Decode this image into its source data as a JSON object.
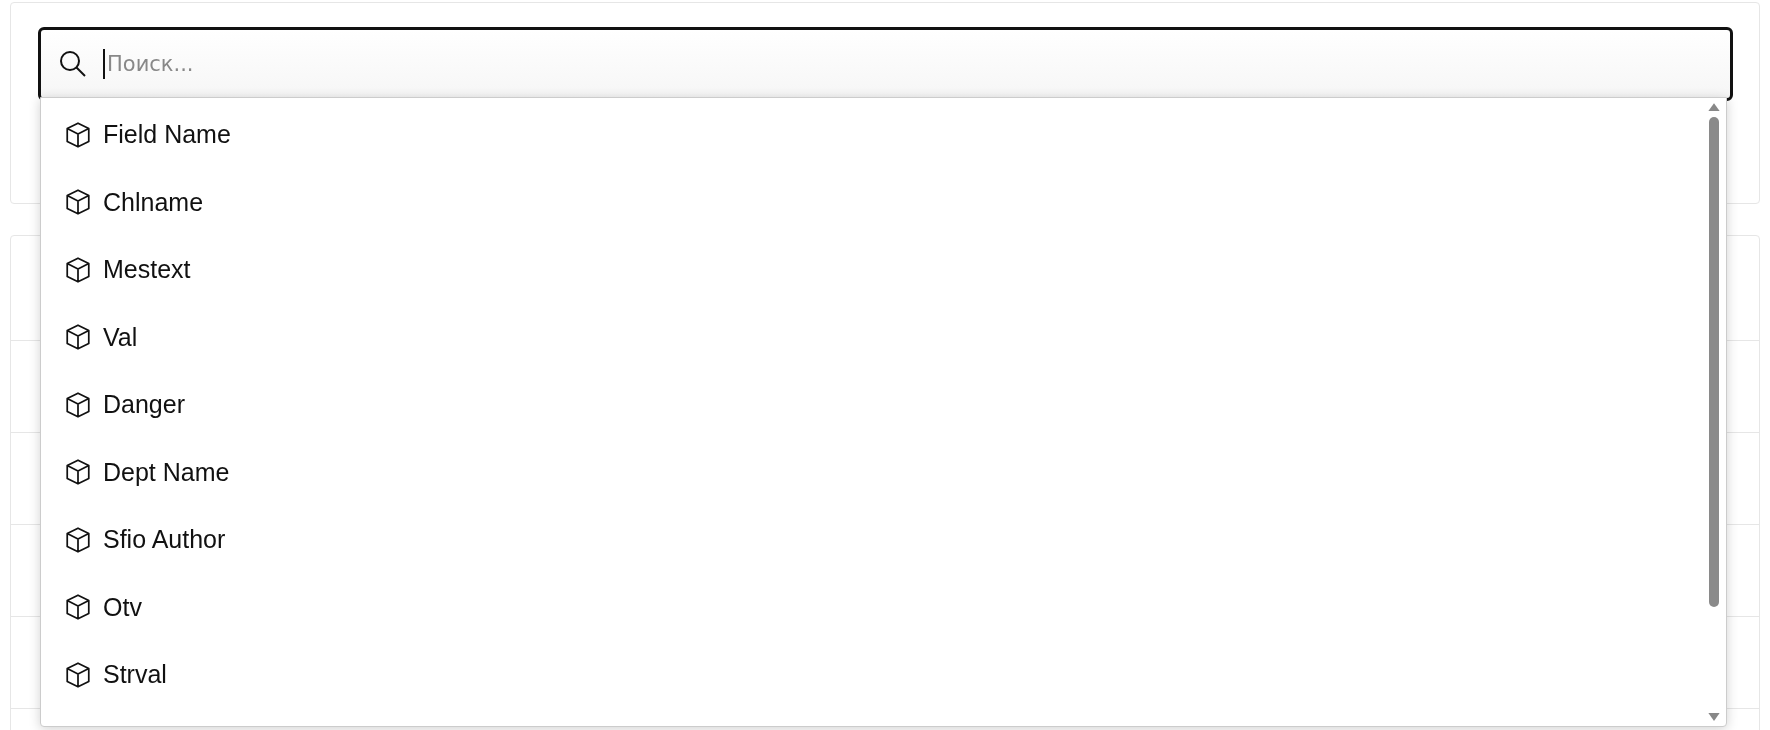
{
  "search": {
    "placeholder": "Поиск..."
  },
  "suggestions": [
    {
      "label": "Field Name"
    },
    {
      "label": "Chlname"
    },
    {
      "label": "Mestext"
    },
    {
      "label": "Val"
    },
    {
      "label": "Danger"
    },
    {
      "label": "Dept Name"
    },
    {
      "label": "Sfio Author"
    },
    {
      "label": "Otv"
    },
    {
      "label": "Strval"
    }
  ]
}
